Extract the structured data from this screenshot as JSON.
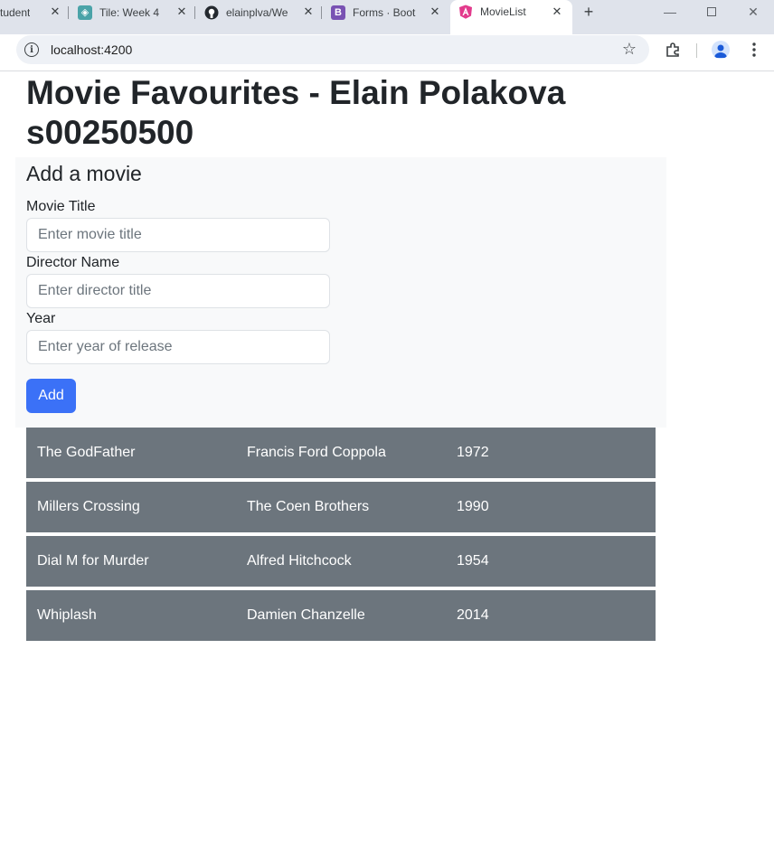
{
  "browser": {
    "tabs": [
      {
        "title": "tudent",
        "icon": "generic-page-icon"
      },
      {
        "title": "Tile: Week 4",
        "icon": "moodle-icon"
      },
      {
        "title": "elainplva/We",
        "icon": "github-icon"
      },
      {
        "title": "Forms · Boot",
        "icon": "bootstrap-icon"
      },
      {
        "title": "MovieList",
        "icon": "angular-icon"
      }
    ],
    "active_tab": 4,
    "address": "localhost:4200"
  },
  "page": {
    "title": "Movie Favourites - Elain Polakova s00250500"
  },
  "form": {
    "heading": "Add a movie",
    "title_label": "Movie Title",
    "title_placeholder": "Enter movie title",
    "director_label": "Director Name",
    "director_placeholder": "Enter director title",
    "year_label": "Year",
    "year_placeholder": "Enter year of release",
    "add_label": "Add"
  },
  "movies": [
    {
      "title": "The GodFather",
      "director": "Francis Ford Coppola",
      "year": "1972"
    },
    {
      "title": "Millers Crossing",
      "director": "The Coen Brothers",
      "year": "1990"
    },
    {
      "title": "Dial M for Murder",
      "director": "Alfred Hitchcock",
      "year": "1954"
    },
    {
      "title": "Whiplash",
      "director": "Damien Chanzelle",
      "year": "2014"
    }
  ],
  "colors": {
    "primary": "#3b71f7",
    "row_bg": "#6c757d",
    "panel_bg": "#f8f9fa"
  }
}
